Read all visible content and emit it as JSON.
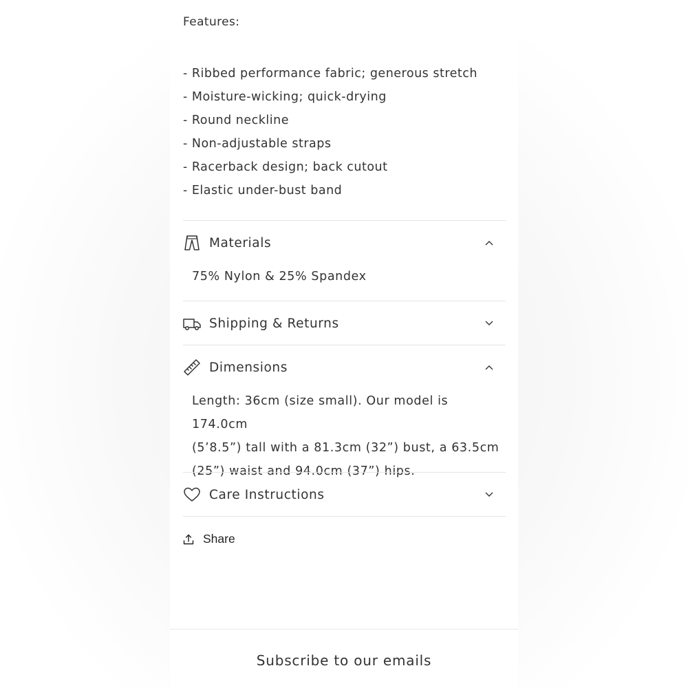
{
  "features": {
    "title": "Features:",
    "items": [
      "- Ribbed performance fabric; generous stretch",
      "- Moisture-wicking; quick-drying",
      "- Round neckline",
      "- Non-adjustable straps",
      "- Racerback design; back cutout",
      "- Elastic under-bust band"
    ]
  },
  "accordions": [
    {
      "title": "Materials",
      "icon": "pants-icon",
      "expanded": true,
      "content": "75% Nylon & 25% Spandex"
    },
    {
      "title": "Shipping & Returns",
      "icon": "truck-icon",
      "expanded": false
    },
    {
      "title": "Dimensions",
      "icon": "ruler-icon",
      "expanded": true,
      "content_lines": [
        "Length: 36cm (size small). Our model is 174.0cm",
        "(5’8.5”) tall with a 81.3cm (32”) bust, a 63.5cm",
        "(25”) waist and 94.0cm (37”) hips."
      ]
    },
    {
      "title": "Care Instructions",
      "icon": "heart-icon",
      "expanded": false
    }
  ],
  "share": {
    "label": "Share",
    "icon": "share-icon"
  },
  "footer": {
    "subscribe_heading": "Subscribe to our emails"
  },
  "colors": {
    "text": "#333333",
    "divider": "#e4e4e4",
    "background": "#ffffff"
  }
}
